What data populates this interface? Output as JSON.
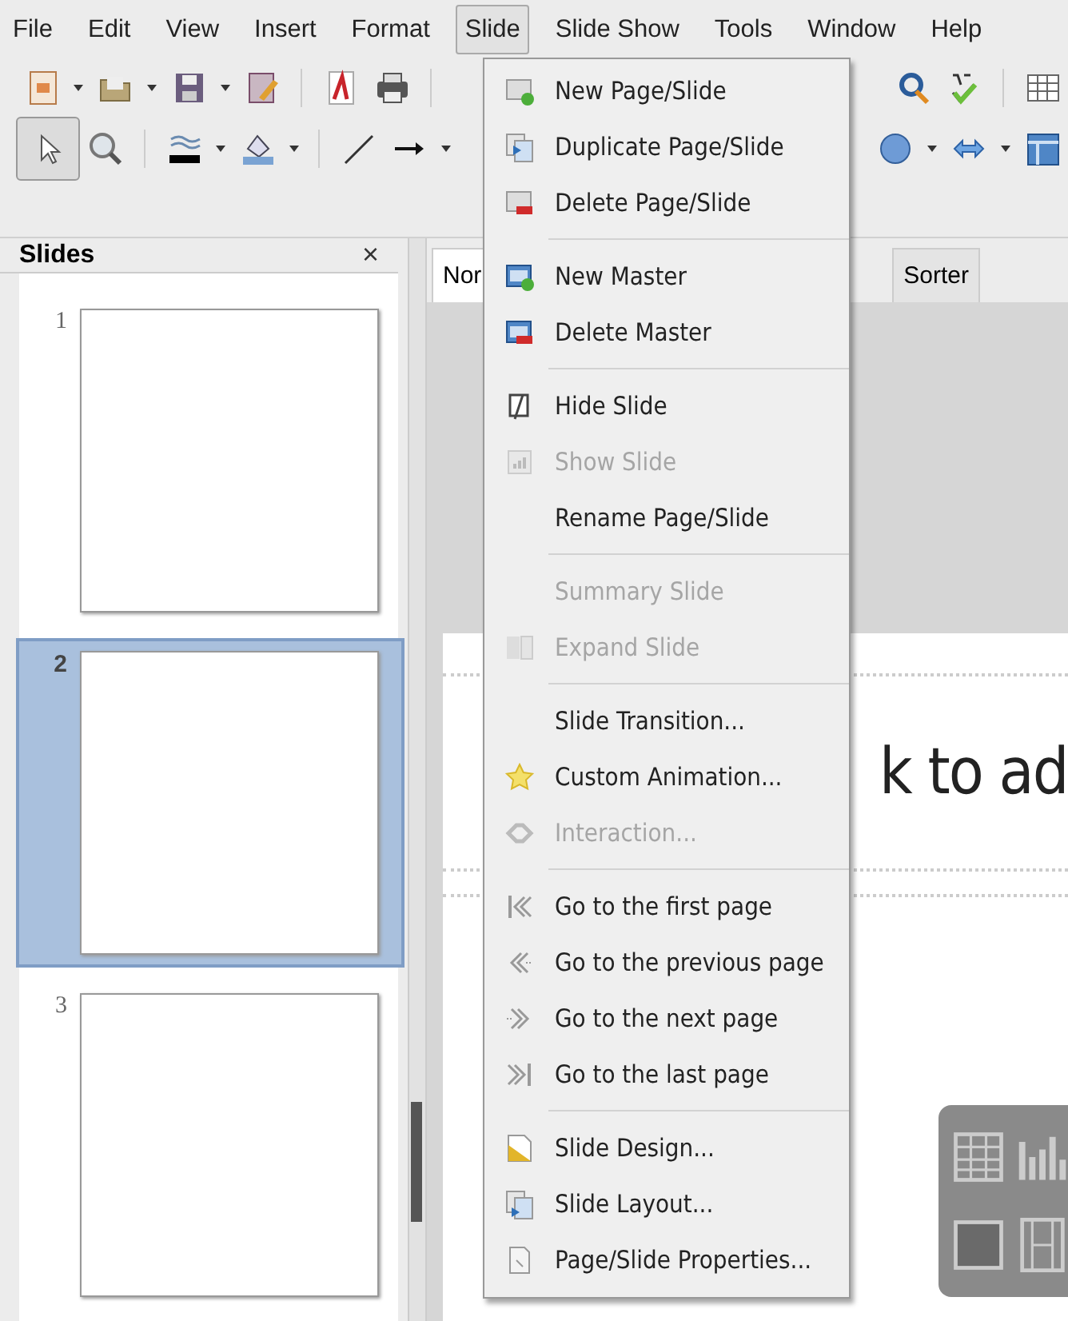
{
  "menubar": [
    {
      "label": "File",
      "selected": false
    },
    {
      "label": "Edit",
      "selected": false
    },
    {
      "label": "View",
      "selected": false
    },
    {
      "label": "Insert",
      "selected": false
    },
    {
      "label": "Format",
      "selected": false
    },
    {
      "label": "Slide",
      "selected": true
    },
    {
      "label": "Slide Show",
      "selected": false
    },
    {
      "label": "Tools",
      "selected": false
    },
    {
      "label": "Window",
      "selected": false
    },
    {
      "label": "Help",
      "selected": false
    }
  ],
  "slides_panel": {
    "title": "Slides",
    "close": "×",
    "slides": [
      {
        "number": "1",
        "selected": false
      },
      {
        "number": "2",
        "selected": true
      },
      {
        "number": "3",
        "selected": false
      }
    ]
  },
  "view_tabs": [
    {
      "label": "Nor",
      "selected": true
    },
    {
      "label": "Sorter",
      "selected": false
    }
  ],
  "slide": {
    "title_placeholder": "k to ad"
  },
  "menu": {
    "items": [
      {
        "kind": "item",
        "label": "New Page/Slide",
        "disabled": false
      },
      {
        "kind": "item",
        "label": "Duplicate Page/Slide",
        "disabled": false
      },
      {
        "kind": "item",
        "label": "Delete Page/Slide",
        "disabled": false
      },
      {
        "kind": "separator"
      },
      {
        "kind": "item",
        "label": "New Master",
        "disabled": false
      },
      {
        "kind": "item",
        "label": "Delete Master",
        "disabled": false
      },
      {
        "kind": "separator"
      },
      {
        "kind": "item",
        "label": "Hide Slide",
        "disabled": false
      },
      {
        "kind": "item",
        "label": "Show Slide",
        "disabled": true
      },
      {
        "kind": "item",
        "label": "Rename Page/Slide",
        "disabled": false
      },
      {
        "kind": "separator"
      },
      {
        "kind": "item",
        "label": "Summary Slide",
        "disabled": true
      },
      {
        "kind": "item",
        "label": "Expand Slide",
        "disabled": true
      },
      {
        "kind": "separator"
      },
      {
        "kind": "item",
        "label": "Slide Transition...",
        "disabled": false
      },
      {
        "kind": "item",
        "label": "Custom Animation...",
        "disabled": false
      },
      {
        "kind": "item",
        "label": "Interaction...",
        "disabled": true
      },
      {
        "kind": "separator"
      },
      {
        "kind": "item",
        "label": "Go to the first page",
        "disabled": false
      },
      {
        "kind": "item",
        "label": "Go to the previous page",
        "disabled": false
      },
      {
        "kind": "item",
        "label": "Go to the next page",
        "disabled": false
      },
      {
        "kind": "item",
        "label": "Go to the last page",
        "disabled": false
      },
      {
        "kind": "separator"
      },
      {
        "kind": "item",
        "label": "Slide Design...",
        "disabled": false
      },
      {
        "kind": "item",
        "label": "Slide Layout...",
        "disabled": false
      },
      {
        "kind": "item",
        "label": "Page/Slide Properties...",
        "disabled": false
      }
    ]
  }
}
